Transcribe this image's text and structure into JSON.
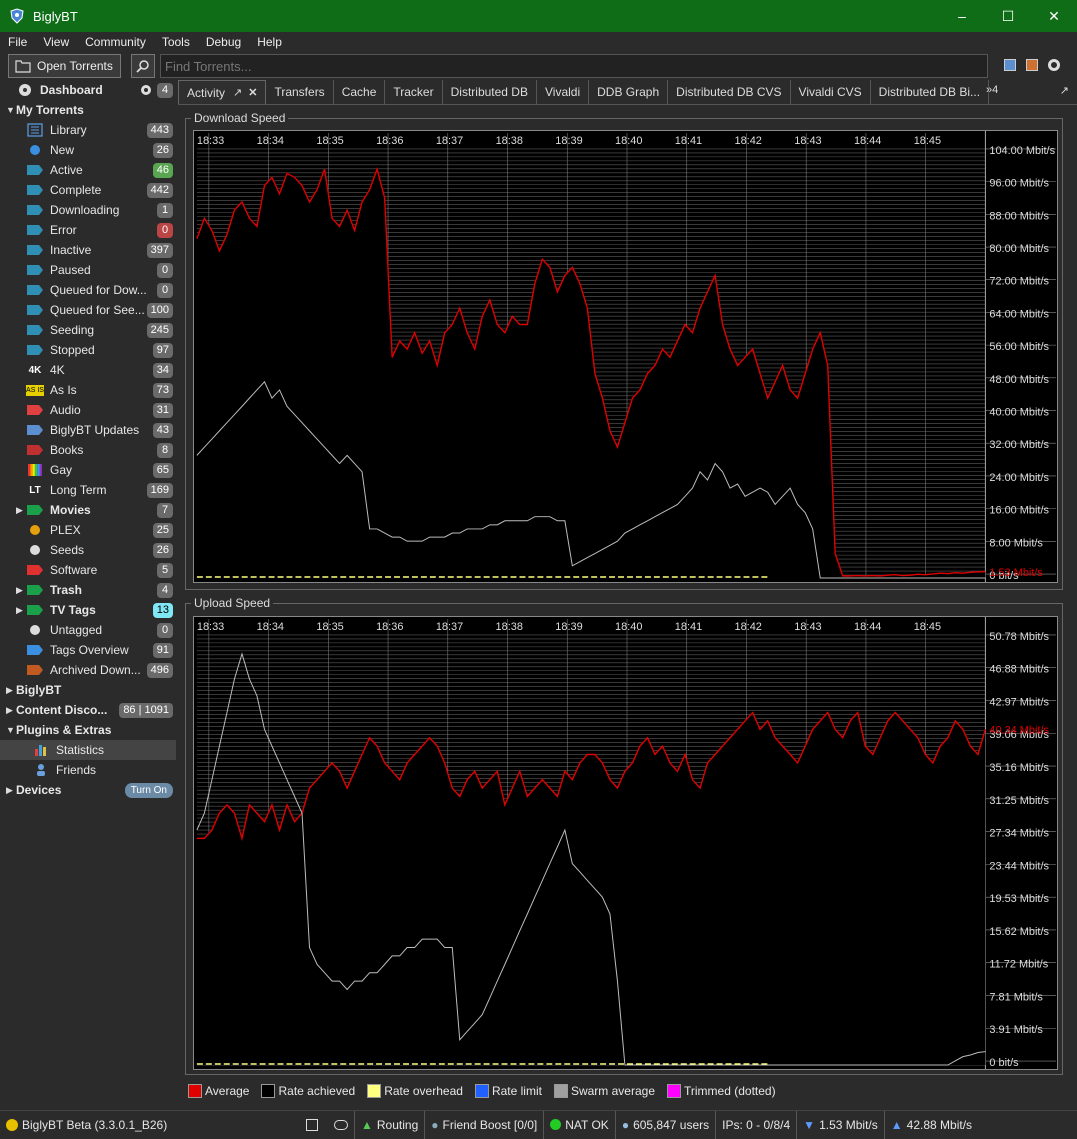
{
  "window": {
    "title": "BiglyBT"
  },
  "menu": [
    "File",
    "View",
    "Community",
    "Tools",
    "Debug",
    "Help"
  ],
  "toolbar": {
    "open_label": "Open Torrents",
    "search_placeholder": "Find Torrents..."
  },
  "sidebar": {
    "dashboard": {
      "label": "Dashboard",
      "count": "4"
    },
    "my_torrents": "My Torrents",
    "items": [
      {
        "label": "Library",
        "count": "443",
        "icon": "library-icon"
      },
      {
        "label": "New",
        "count": "26",
        "icon": "new-icon"
      },
      {
        "label": "Active",
        "count": "46",
        "icon": "active-icon",
        "badge": "green"
      },
      {
        "label": "Complete",
        "count": "442",
        "icon": "complete-icon"
      },
      {
        "label": "Downloading",
        "count": "1",
        "icon": "downloading-icon"
      },
      {
        "label": "Error",
        "count": "0",
        "icon": "error-icon",
        "badge": "red"
      },
      {
        "label": "Inactive",
        "count": "397",
        "icon": "inactive-icon"
      },
      {
        "label": "Paused",
        "count": "0",
        "icon": "paused-icon"
      },
      {
        "label": "Queued for Dow...",
        "count": "0",
        "icon": "queued-download-icon"
      },
      {
        "label": "Queued for See...",
        "count": "100",
        "icon": "queued-seed-icon"
      },
      {
        "label": "Seeding",
        "count": "245",
        "icon": "seeding-icon"
      },
      {
        "label": "Stopped",
        "count": "97",
        "icon": "stopped-icon"
      },
      {
        "label": "4K",
        "count": "34",
        "icon": "4k-icon"
      },
      {
        "label": "As Is",
        "count": "73",
        "icon": "as-is-icon"
      },
      {
        "label": "Audio",
        "count": "31",
        "icon": "audio-icon"
      },
      {
        "label": "BiglyBT Updates",
        "count": "43",
        "icon": "biglybt-updates-icon"
      },
      {
        "label": "Books",
        "count": "8",
        "icon": "books-icon"
      },
      {
        "label": "Gay",
        "count": "65",
        "icon": "rainbow-icon"
      },
      {
        "label": "Long Term",
        "count": "169",
        "icon": "long-term-icon"
      },
      {
        "label": "Movies",
        "count": "7",
        "icon": "movies-icon",
        "bold": true,
        "expander": true
      },
      {
        "label": "PLEX",
        "count": "25",
        "icon": "plex-icon"
      },
      {
        "label": "Seeds",
        "count": "26",
        "icon": "seeds-icon"
      },
      {
        "label": "Software",
        "count": "5",
        "icon": "software-icon"
      },
      {
        "label": "Trash",
        "count": "4",
        "icon": "trash-icon",
        "bold": true,
        "expander": true
      },
      {
        "label": "TV Tags",
        "count": "13",
        "icon": "tv-tags-icon",
        "bold": true,
        "expander": true,
        "badge": "cyan"
      },
      {
        "label": "Untagged",
        "count": "0",
        "icon": "untagged-icon"
      },
      {
        "label": "Tags Overview",
        "count": "91",
        "icon": "tags-overview-icon"
      },
      {
        "label": "Archived Down...",
        "count": "496",
        "icon": "archive-icon"
      }
    ],
    "sections": [
      {
        "label": "BiglyBT"
      },
      {
        "label": "Content Disco...",
        "count": "86 | 1091"
      },
      {
        "label": "Plugins & Extras"
      }
    ],
    "plugins": [
      {
        "label": "Statistics",
        "icon": "statistics-icon"
      },
      {
        "label": "Friends",
        "icon": "friends-icon"
      }
    ],
    "devices": {
      "label": "Devices",
      "badge": "Turn On"
    }
  },
  "tabs": [
    "Activity",
    "Transfers",
    "Cache",
    "Tracker",
    "Distributed DB",
    "Vivaldi",
    "DDB Graph",
    "Distributed DB CVS",
    "Vivaldi CVS",
    "Distributed DB Bi..."
  ],
  "tab_more": "»4",
  "download": {
    "title": "Download Speed",
    "times": [
      "18:33",
      "18:34",
      "18:35",
      "18:36",
      "18:37",
      "18:38",
      "18:39",
      "18:40",
      "18:41",
      "18:42",
      "18:43",
      "18:44",
      "18:45"
    ],
    "yticks": [
      "104.00 Mbit/s",
      "96.00 Mbit/s",
      "88.00 Mbit/s",
      "80.00 Mbit/s",
      "72.00 Mbit/s",
      "64.00 Mbit/s",
      "56.00 Mbit/s",
      "48.00 Mbit/s",
      "40.00 Mbit/s",
      "32.00 Mbit/s",
      "24.00 Mbit/s",
      "16.00 Mbit/s",
      "8.00 Mbit/s",
      "0 bit/s"
    ],
    "current": "1.53 Mbit/s",
    "ymax": 104,
    "rate": [
      83,
      88,
      85,
      80,
      84,
      90,
      92,
      88,
      86,
      96,
      98,
      94,
      99,
      98,
      96,
      92,
      95,
      100,
      88,
      86,
      90,
      85,
      92,
      95,
      100,
      93,
      54,
      58,
      56,
      60,
      55,
      58,
      52,
      60,
      62,
      66,
      60,
      56,
      64,
      68,
      62,
      60,
      64,
      62,
      62,
      72,
      78,
      76,
      70,
      74,
      76,
      72,
      66,
      50,
      44,
      36,
      32,
      38,
      44,
      46,
      50,
      52,
      56,
      54,
      58,
      62,
      60,
      66,
      70,
      74,
      62,
      56,
      52,
      54,
      56,
      50,
      44,
      48,
      52,
      46,
      44,
      50,
      56,
      60,
      52,
      6,
      0.5,
      0.5,
      0.6,
      0.5,
      0.6,
      0.5,
      0.7,
      0.8,
      0.6,
      0.7,
      0.9,
      0.8,
      1.0,
      1.2,
      1.1,
      1.3,
      1.2,
      1.4,
      1.5,
      1.5
    ],
    "swarm": [
      30,
      32,
      34,
      36,
      38,
      40,
      42,
      44,
      46,
      48,
      44,
      46,
      42,
      40,
      38,
      36,
      34,
      32,
      30,
      28,
      30,
      28,
      26,
      12,
      12,
      11,
      10,
      10,
      9,
      9,
      9,
      10,
      10,
      10,
      11,
      11,
      12,
      12,
      12,
      13,
      13,
      14,
      14,
      14,
      14,
      15,
      15,
      15,
      14,
      14,
      3,
      4,
      5,
      6,
      7,
      8,
      9,
      11,
      12,
      13,
      14,
      15,
      16,
      17,
      18,
      20,
      22,
      26,
      24,
      28,
      26,
      22,
      23,
      20,
      21,
      22,
      21,
      18,
      20,
      22,
      18,
      16,
      12,
      0,
      0,
      0,
      0,
      0,
      0,
      0,
      0,
      0,
      0,
      0,
      0,
      0,
      0,
      0,
      0,
      0,
      0,
      0,
      0,
      0,
      0,
      0
    ]
  },
  "upload": {
    "title": "Upload Speed",
    "times": [
      "18:33",
      "18:34",
      "18:35",
      "18:36",
      "18:37",
      "18:38",
      "18:39",
      "18:40",
      "18:41",
      "18:42",
      "18:43",
      "18:44",
      "18:45"
    ],
    "yticks": [
      "50.78 Mbit/s",
      "46.88 Mbit/s",
      "42.97 Mbit/s",
      "39.06 Mbit/s",
      "35.16 Mbit/s",
      "31.25 Mbit/s",
      "27.34 Mbit/s",
      "23.44 Mbit/s",
      "19.53 Mbit/s",
      "15.62 Mbit/s",
      "11.72 Mbit/s",
      "7.81 Mbit/s",
      "3.91 Mbit/s",
      "0 bit/s"
    ],
    "current": "40.34 Mbit/s",
    "ymax": 50.78,
    "rate": [
      27,
      27,
      28,
      30,
      31,
      30,
      27,
      31,
      30,
      29,
      31,
      28,
      31,
      29,
      30,
      33,
      34,
      35,
      36,
      35,
      33,
      35,
      37,
      39,
      38,
      36,
      35,
      34,
      36,
      37,
      38,
      39,
      38,
      36,
      33,
      32,
      34,
      35,
      33,
      34,
      35,
      31,
      33,
      35,
      32,
      33,
      34,
      33,
      32,
      35,
      34,
      36,
      37,
      37,
      36,
      34,
      33,
      35,
      36,
      38,
      39,
      37,
      38,
      36,
      35,
      37,
      34,
      33,
      36,
      37,
      38,
      39,
      40,
      41,
      42,
      40,
      41,
      39,
      38,
      37,
      36,
      38,
      40,
      41,
      42,
      40,
      39,
      41,
      42,
      38,
      37,
      39,
      41,
      42,
      41,
      40,
      39,
      37,
      36,
      38,
      39,
      41,
      40,
      38,
      37,
      40
    ],
    "swarm": [
      28,
      30,
      34,
      38,
      42,
      46,
      49,
      46,
      44,
      40,
      38,
      36,
      34,
      32,
      30,
      14,
      12,
      11,
      10,
      10,
      9,
      10,
      10,
      11,
      11,
      12,
      13,
      13,
      14,
      14,
      15,
      15,
      15,
      14,
      14,
      3,
      4,
      5,
      6,
      8,
      10,
      12,
      14,
      16,
      18,
      20,
      22,
      24,
      26,
      28,
      24,
      23,
      22,
      21,
      20,
      18,
      10,
      0,
      0,
      0,
      0,
      0,
      0,
      0,
      0,
      0,
      0,
      0,
      0,
      0,
      0,
      0,
      0,
      0,
      0,
      0,
      0,
      0,
      0,
      0,
      0,
      0,
      0,
      0,
      0,
      0,
      0,
      0,
      0,
      0,
      0,
      0,
      0,
      0,
      0,
      0,
      0,
      0,
      0,
      0,
      0,
      0.5,
      1,
      1.2,
      1.5,
      1.6
    ]
  },
  "legend": [
    {
      "label": "Average",
      "color": "#e00000"
    },
    {
      "label": "Rate achieved",
      "color": "#000000"
    },
    {
      "label": "Rate overhead",
      "color": "#ffff80"
    },
    {
      "label": "Rate limit",
      "color": "#2060ff"
    },
    {
      "label": "Swarm average",
      "color": "#a0a0a0"
    },
    {
      "label": "Trimmed (dotted)",
      "color": "#ff00ff"
    }
  ],
  "status": {
    "version": "BiglyBT Beta (3.3.0.1_B26)",
    "routing": "Routing",
    "friend_boost": "Friend Boost [0/0]",
    "nat": "NAT OK",
    "users": "605,847 users",
    "ips": "IPs: 0 - 0/8/4",
    "down": "1.53 Mbit/s",
    "up": "42.88 Mbit/s"
  }
}
